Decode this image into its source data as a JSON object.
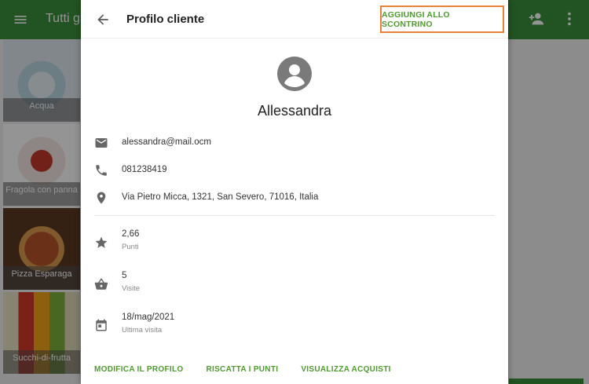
{
  "app": {
    "title": "Tutti g",
    "tiles": [
      {
        "caption": "Acqua",
        "img": "water"
      },
      {
        "caption": "Fragola con panna",
        "img": "strawberry"
      },
      {
        "caption": "Pizza Esparaga",
        "img": "pizza"
      },
      {
        "caption": "Succhi-di-frutta",
        "img": "juice"
      }
    ],
    "icons": {
      "menu": "menu-icon",
      "add_person": "person-add-icon",
      "more": "more-vert-icon"
    }
  },
  "dialog": {
    "title": "Profilo cliente",
    "add_to_receipt": "AGGIUNGI ALLO SCONTRINO",
    "customer_name": "Allessandra",
    "email": "alessandra@mail.ocm",
    "phone": "081238419",
    "address": "Via Pietro Micca, 1321, San Severo, 71016, Italia",
    "points_value": "2,66",
    "points_label": "Punti",
    "visits_value": "5",
    "visits_label": "Visite",
    "last_visit_value": "18/mag/2021",
    "last_visit_label": "Ultima visita",
    "actions": {
      "edit_profile": "MODIFICA IL PROFILO",
      "redeem_points": "RISCATTA I PUNTI",
      "view_purchases": "VISUALIZZA ACQUISTI"
    }
  },
  "colors": {
    "primary": "#3b8f3b",
    "accent_text": "#4f9a2f",
    "highlight_border": "#e8823a"
  }
}
